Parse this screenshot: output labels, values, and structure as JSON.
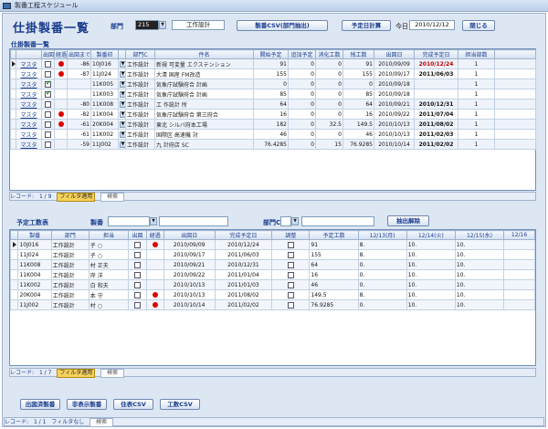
{
  "window": {
    "title": "製番工程スケジュール"
  },
  "header": {
    "page_title": "仕掛製番一覧",
    "dept_label": "部門",
    "dept_code": "215",
    "dept_name": "工作設計",
    "btn_csv_dept": "製番CSV(部門抽出)",
    "btn_plan_total": "予定日計算",
    "today_label": "今日",
    "today_value": "2010/12/12",
    "btn_close": "閉じる"
  },
  "upper": {
    "section_label": "仕掛製番一覧",
    "columns": [
      "",
      "",
      "出図",
      "経過",
      "出図まで",
      "製番印",
      "",
      "部門C",
      "件名",
      "開始予定",
      "追加予定",
      "消化工数",
      "残工数",
      "出図日",
      "完成予定日",
      "担当部数"
    ],
    "rows": [
      {
        "btn": "マスタ",
        "out": false,
        "red": true,
        "until": "-86",
        "no": "10J016",
        "dept": "工作設計",
        "name": "新規 可変量 エクステンション",
        "start": "91",
        "add": "0",
        "used": "0",
        "remain": "91",
        "date": "2010/09/09",
        "finish": "2010/12/24",
        "finish_red": true,
        "qty": "1"
      },
      {
        "btn": "マスタ",
        "out": false,
        "red": true,
        "until": "-87",
        "no": "11J024",
        "dept": "工作設計",
        "name": "大清 国産 FM改造",
        "start": "155",
        "add": "0",
        "used": "0",
        "remain": "155",
        "date": "2010/09/17",
        "finish": "2011/06/03",
        "finish_red": false,
        "qty": "1"
      },
      {
        "btn": "マスタ",
        "out": true,
        "red": false,
        "until": "",
        "no": "11K005",
        "dept": "工作設計",
        "name": "気象庁試験府合 計画",
        "start": "0",
        "add": "0",
        "used": "0",
        "remain": "0",
        "date": "2010/09/18",
        "finish": "",
        "finish_red": false,
        "qty": "1"
      },
      {
        "btn": "マスタ",
        "out": true,
        "red": false,
        "until": "",
        "no": "11K003",
        "dept": "工作設計",
        "name": "気象庁試験府合 計画",
        "start": "85",
        "add": "0",
        "used": "0",
        "remain": "85",
        "date": "2010/09/18",
        "finish": "",
        "finish_red": false,
        "qty": "1"
      },
      {
        "btn": "マスタ",
        "out": false,
        "red": false,
        "until": "-80",
        "no": "11K008",
        "dept": "工作設計",
        "name": "工 作設計 所",
        "start": "64",
        "add": "0",
        "used": "0",
        "remain": "64",
        "date": "2010/09/21",
        "finish": "2010/12/31",
        "finish_red": false,
        "qty": "1"
      },
      {
        "btn": "マスタ",
        "out": false,
        "red": true,
        "until": "-82",
        "no": "11K004",
        "dept": "工作設計",
        "name": "気象庁試験府合 第三府合",
        "start": "16",
        "add": "0",
        "used": "0",
        "remain": "16",
        "date": "2010/09/22",
        "finish": "2011/07/04",
        "finish_red": false,
        "qty": "1"
      },
      {
        "btn": "マスタ",
        "out": false,
        "red": true,
        "until": "-61",
        "no": "20K004",
        "dept": "工作設計",
        "name": "東北 シルバ府本工場",
        "start": "182",
        "add": "0",
        "used": "32.5",
        "remain": "149.5",
        "date": "2010/10/13",
        "finish": "2011/08/02",
        "finish_red": false,
        "qty": "1"
      },
      {
        "btn": "マスタ",
        "out": false,
        "red": false,
        "until": "-61",
        "no": "11K002",
        "dept": "工作設計",
        "name": "国際区 高速機 対",
        "start": "46",
        "add": "0",
        "used": "0",
        "remain": "46",
        "date": "2010/10/13",
        "finish": "2011/02/03",
        "finish_red": false,
        "qty": "1"
      },
      {
        "btn": "マスタ",
        "out": false,
        "red": false,
        "until": "-59",
        "no": "11J002",
        "dept": "工作設計",
        "name": "九 計府店 SC",
        "start": "76.4285",
        "add": "0",
        "used": "15",
        "remain": "76.9285",
        "date": "2010/10/14",
        "finish": "2011/02/02",
        "finish_red": false,
        "qty": "1"
      }
    ],
    "recbar": {
      "label": "レコード:",
      "pos": "1 / 9",
      "filter": "フィルタ適用",
      "search": "検索"
    }
  },
  "lower": {
    "section_label": "予定工数表",
    "seiban_label": "製番",
    "dept_label": "部門C",
    "btn_extract": "抽出解除",
    "columns": [
      "製番",
      "部門",
      "担当",
      "出図",
      "経過",
      "出図日",
      "完成予定日",
      "調整",
      "予定工数",
      "12/13(月)",
      "12/14(火)",
      "12/15(水)",
      "12/16"
    ],
    "rows": [
      {
        "no": "10J016",
        "dept": "工作設計",
        "person": "子 ○",
        "red": true,
        "date": "2010/09/09",
        "finish": "2010/12/24",
        "plan": "91",
        "d1": "8.",
        "d2": "10.",
        "d3": "10."
      },
      {
        "no": "11J024",
        "dept": "工作設計",
        "person": "子 ○",
        "red": false,
        "date": "2010/09/17",
        "finish": "2011/06/03",
        "plan": "155",
        "d1": "8.",
        "d2": "10.",
        "d3": "10."
      },
      {
        "no": "11K008",
        "dept": "工作設計",
        "person": "村 正夫",
        "red": false,
        "date": "2010/09/21",
        "finish": "2010/12/31",
        "plan": "64",
        "d1": "0.",
        "d2": "10.",
        "d3": "10."
      },
      {
        "no": "11K004",
        "dept": "工作設計",
        "person": "岸 洋",
        "red": false,
        "date": "2010/09/22",
        "finish": "2011/01/04",
        "plan": "16",
        "d1": "0.",
        "d2": "10.",
        "d3": "10."
      },
      {
        "no": "11K002",
        "dept": "工作設計",
        "person": "白 和夫",
        "red": false,
        "date": "2010/10/13",
        "finish": "2011/01/03",
        "plan": "46",
        "d1": "0.",
        "d2": "10.",
        "d3": "10."
      },
      {
        "no": "20K004",
        "dept": "工作設計",
        "person": "本 守",
        "red": true,
        "date": "2010/10/13",
        "finish": "2011/08/02",
        "plan": "149.5",
        "d1": "8.",
        "d2": "10.",
        "d3": "10."
      },
      {
        "no": "11J002",
        "dept": "工作設計",
        "person": "村 ○",
        "red": true,
        "date": "2010/10/14",
        "finish": "2011/02/02",
        "plan": "76.9285",
        "d1": "0.",
        "d2": "10.",
        "d3": "10."
      }
    ],
    "recbar": {
      "label": "レコード:",
      "pos": "1 / 7",
      "filter": "フィルタ適用",
      "search": "検索"
    }
  },
  "footer": {
    "btn1": "出図済製番",
    "btn2": "非表示製番",
    "btn3": "住表CSV",
    "btn4": "工数CSV",
    "recbar": {
      "label": "レコード:",
      "pos": "1 / 1",
      "filter": "フィルタなし",
      "search": "検索"
    }
  }
}
